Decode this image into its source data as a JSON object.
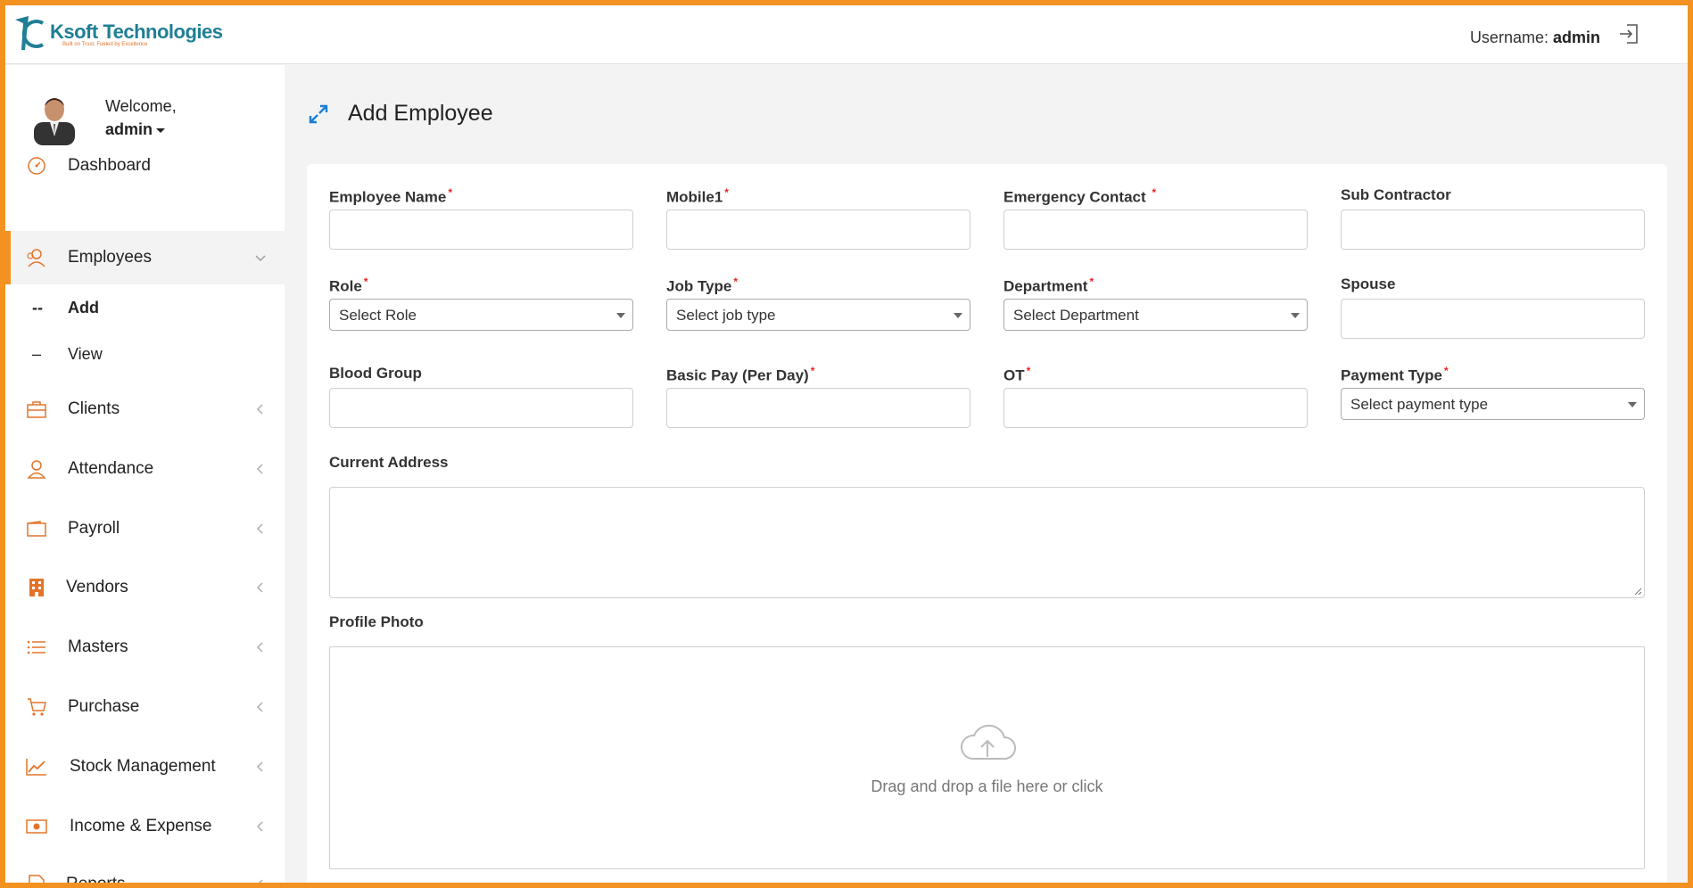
{
  "brand": {
    "name": "Ksoft Technologies",
    "tagline": "Built on Trust, Fueled by Excellence"
  },
  "header": {
    "username_label": "Username:",
    "username_value": "admin"
  },
  "sidebar": {
    "welcome": "Welcome,",
    "user": "admin",
    "items": [
      {
        "label": "Dashboard",
        "icon": "dashboard-icon"
      },
      {
        "label": "Employees",
        "icon": "employees-icon"
      },
      {
        "label": "Clients",
        "icon": "briefcase-icon"
      },
      {
        "label": "Attendance",
        "icon": "user-icon"
      },
      {
        "label": "Payroll",
        "icon": "wallet-icon"
      },
      {
        "label": "Vendors",
        "icon": "building-icon"
      },
      {
        "label": "Masters",
        "icon": "list-icon"
      },
      {
        "label": "Purchase",
        "icon": "cart-icon"
      },
      {
        "label": "Stock Management",
        "icon": "chart-line-icon"
      },
      {
        "label": "Income & Expense",
        "icon": "money-icon"
      },
      {
        "label": "Reports",
        "icon": "report-icon"
      }
    ],
    "subitems": [
      {
        "dash": "--",
        "label": "Add"
      },
      {
        "dash": "–",
        "label": "View"
      }
    ]
  },
  "page": {
    "title": "Add Employee"
  },
  "form": {
    "employee_name": {
      "label": "Employee Name",
      "value": ""
    },
    "mobile1": {
      "label": "Mobile1",
      "value": ""
    },
    "emergency_contact": {
      "label": "Emergency Contact",
      "value": ""
    },
    "sub_contractor": {
      "label": "Sub Contractor",
      "value": ""
    },
    "role": {
      "label": "Role",
      "selected": "Select Role"
    },
    "job_type": {
      "label": "Job Type",
      "selected": "Select job type"
    },
    "department": {
      "label": "Department",
      "selected": "Select Department"
    },
    "spouse": {
      "label": "Spouse",
      "value": ""
    },
    "blood_group": {
      "label": "Blood Group",
      "value": ""
    },
    "basic_pay": {
      "label": "Basic Pay (Per Day)",
      "value": ""
    },
    "ot": {
      "label": "OT",
      "value": ""
    },
    "payment_type": {
      "label": "Payment Type",
      "selected": "Select payment type"
    },
    "current_address": {
      "label": "Current Address",
      "value": ""
    },
    "profile_photo": {
      "label": "Profile Photo",
      "dropzone_text": "Drag and drop a file here or click"
    },
    "required_mark": "*"
  },
  "colors": {
    "accent": "#f39221",
    "brand_teal": "#1f7f95",
    "icon_blue": "#1a7fd4"
  }
}
